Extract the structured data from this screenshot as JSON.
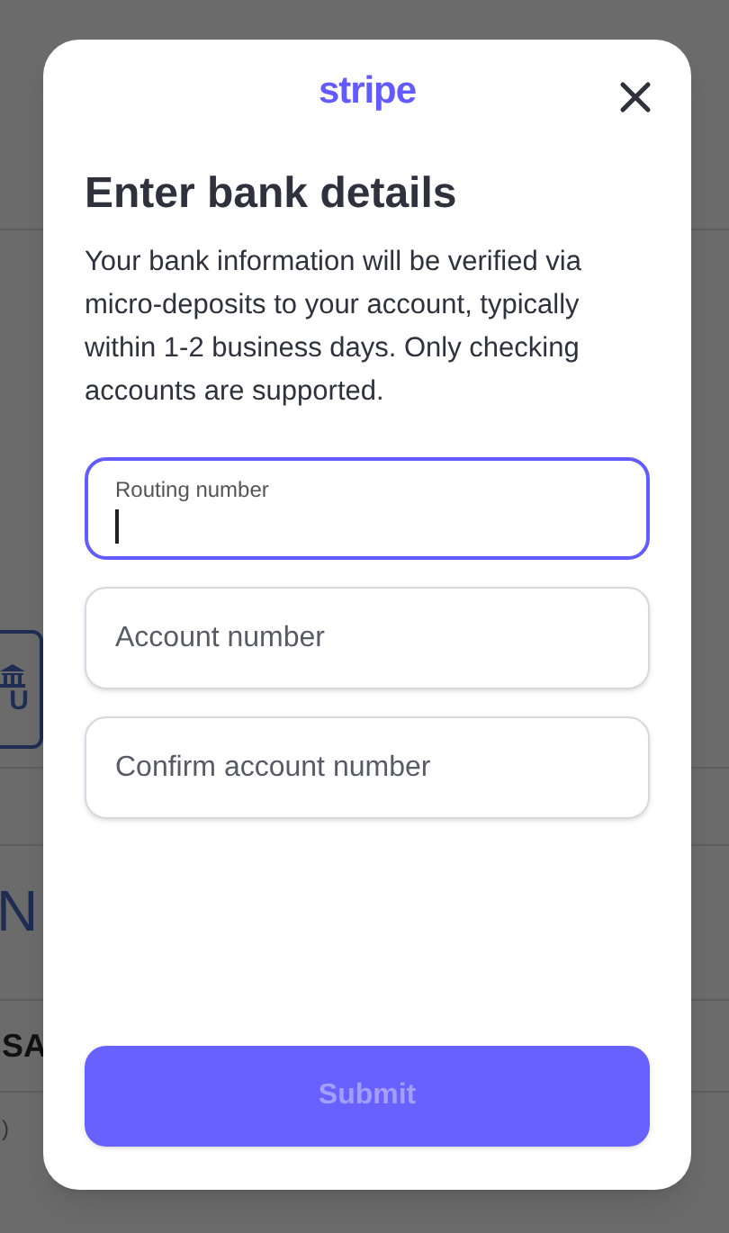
{
  "background": {
    "bank_button": {
      "label": "U"
    },
    "heading_fragment": "N",
    "name_fragment": "SA",
    "note_fragment": ")"
  },
  "modal": {
    "logo": "stripe",
    "title": "Enter bank details",
    "description": "Your bank information will be verified via micro-deposits to your account, typically within 1-2 business days. Only checking accounts are supported.",
    "fields": [
      {
        "label": "Routing number",
        "focused": true
      },
      {
        "label": "Account number",
        "focused": false
      },
      {
        "label": "Confirm account number",
        "focused": false
      }
    ],
    "submit": {
      "label": "Submit",
      "disabled": true
    }
  }
}
